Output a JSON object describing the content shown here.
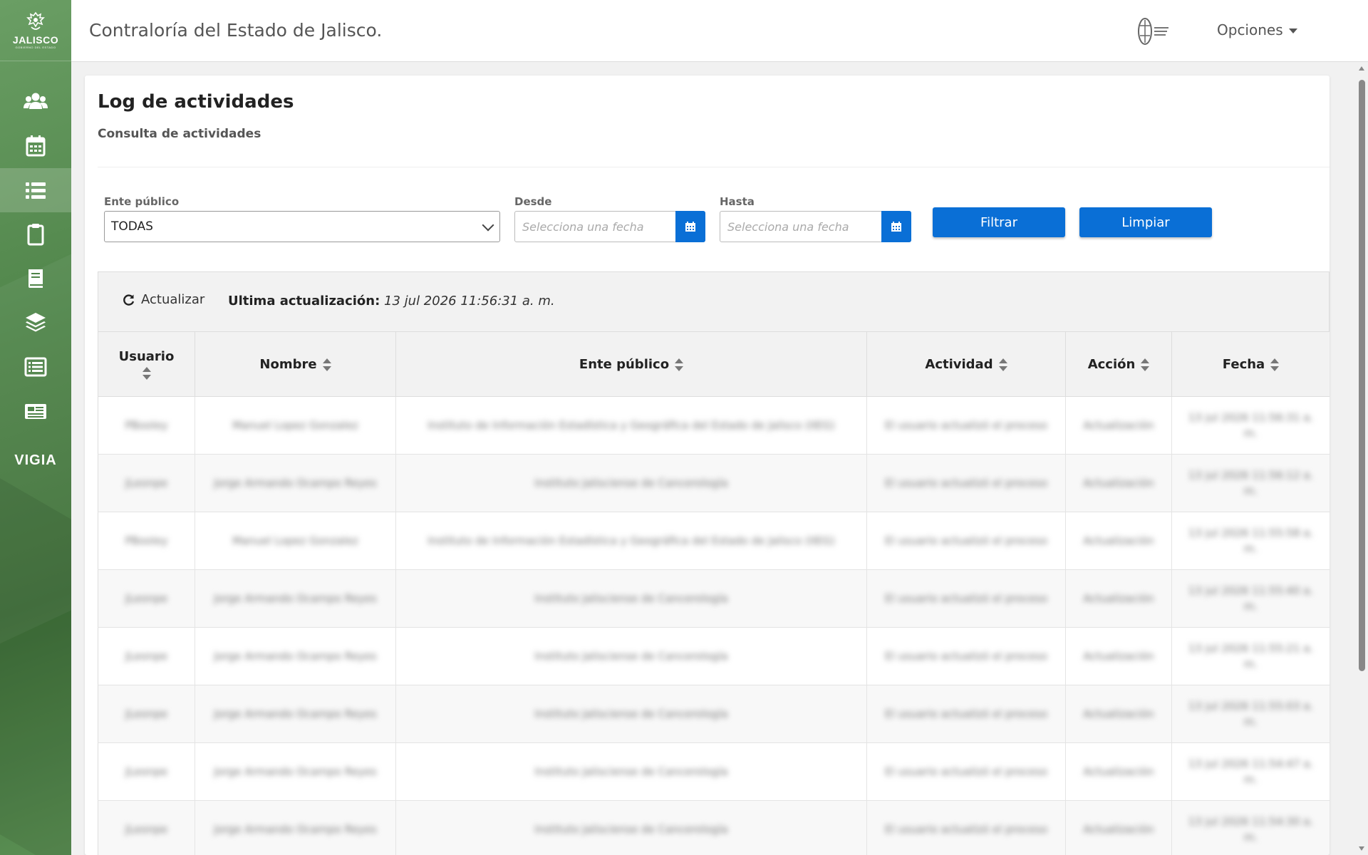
{
  "sidebar": {
    "logo_name": "JALISCO",
    "logo_sub": "GOBIERNO DEL ESTADO",
    "vigia_label": "VIGIA"
  },
  "header": {
    "title": "Contraloría del Estado de Jalisco.",
    "options_label": "Opciones"
  },
  "page": {
    "title": "Log de actividades",
    "subtitle": "Consulta de actividades"
  },
  "filters": {
    "ente_label": "Ente público",
    "ente_value": "TODAS",
    "desde_label": "Desde",
    "desde_placeholder": "Selecciona una fecha",
    "hasta_label": "Hasta",
    "hasta_placeholder": "Selecciona una fecha",
    "filtrar_label": "Filtrar",
    "limpiar_label": "Limpiar"
  },
  "toolbar": {
    "refresh_label": "Actualizar",
    "last_update_label": "Ultima actualización:",
    "last_update_value": "13 jul 2026 11:56:31 a. m."
  },
  "table": {
    "columns": [
      "Usuario",
      "Nombre",
      "Ente público",
      "Actividad",
      "Acción",
      "Fecha"
    ],
    "rows": [
      [
        "PBooley",
        "Manuel Lopez Gonzalez",
        "Instituto de Información Estadística y Geográfica del Estado de Jalisco (IIEG)",
        "El usuario actualizó el proceso",
        "Actualización",
        "13 jul 2026 11:56:31 a. m."
      ],
      [
        "JLeonpe",
        "Jorge Armando Ocampo Reyes",
        "Instituto Jalisciense de Cancerología",
        "El usuario actualizó el proceso",
        "Actualización",
        "13 jul 2026 11:56:12 a. m."
      ],
      [
        "PBooley",
        "Manuel Lopez Gonzalez",
        "Instituto de Información Estadística y Geográfica del Estado de Jalisco (IIEG)",
        "El usuario actualizó el proceso",
        "Actualización",
        "13 jul 2026 11:55:58 a. m."
      ],
      [
        "JLeonpe",
        "Jorge Armando Ocampo Reyes",
        "Instituto Jalisciense de Cancerología",
        "El usuario actualizó el proceso",
        "Actualización",
        "13 jul 2026 11:55:40 a. m."
      ],
      [
        "JLeonpe",
        "Jorge Armando Ocampo Reyes",
        "Instituto Jalisciense de Cancerología",
        "El usuario actualizó el proceso",
        "Actualización",
        "13 jul 2026 11:55:21 a. m."
      ],
      [
        "JLeonpe",
        "Jorge Armando Ocampo Reyes",
        "Instituto Jalisciense de Cancerología",
        "El usuario actualizó el proceso",
        "Actualización",
        "13 jul 2026 11:55:03 a. m."
      ],
      [
        "JLeonpe",
        "Jorge Armando Ocampo Reyes",
        "Instituto Jalisciense de Cancerología",
        "El usuario actualizó el proceso",
        "Actualización",
        "13 jul 2026 11:54:47 a. m."
      ],
      [
        "JLeonpe",
        "Jorge Armando Ocampo Reyes",
        "Instituto Jalisciense de Cancerología",
        "El usuario actualizó el proceso",
        "Actualización",
        "13 jul 2026 11:54:30 a. m."
      ]
    ]
  },
  "colors": {
    "sidebar_green": "#4f8449",
    "primary_blue": "#0a6fd6"
  },
  "icons": [
    "users-icon",
    "calendar-icon",
    "list-icon",
    "clipboard-icon",
    "book-icon",
    "layers-icon",
    "list-alt-icon",
    "news-icon",
    "refresh-icon",
    "sort-icon",
    "chevron-down-icon",
    "calendar-button-icon",
    "caret-down-icon"
  ]
}
